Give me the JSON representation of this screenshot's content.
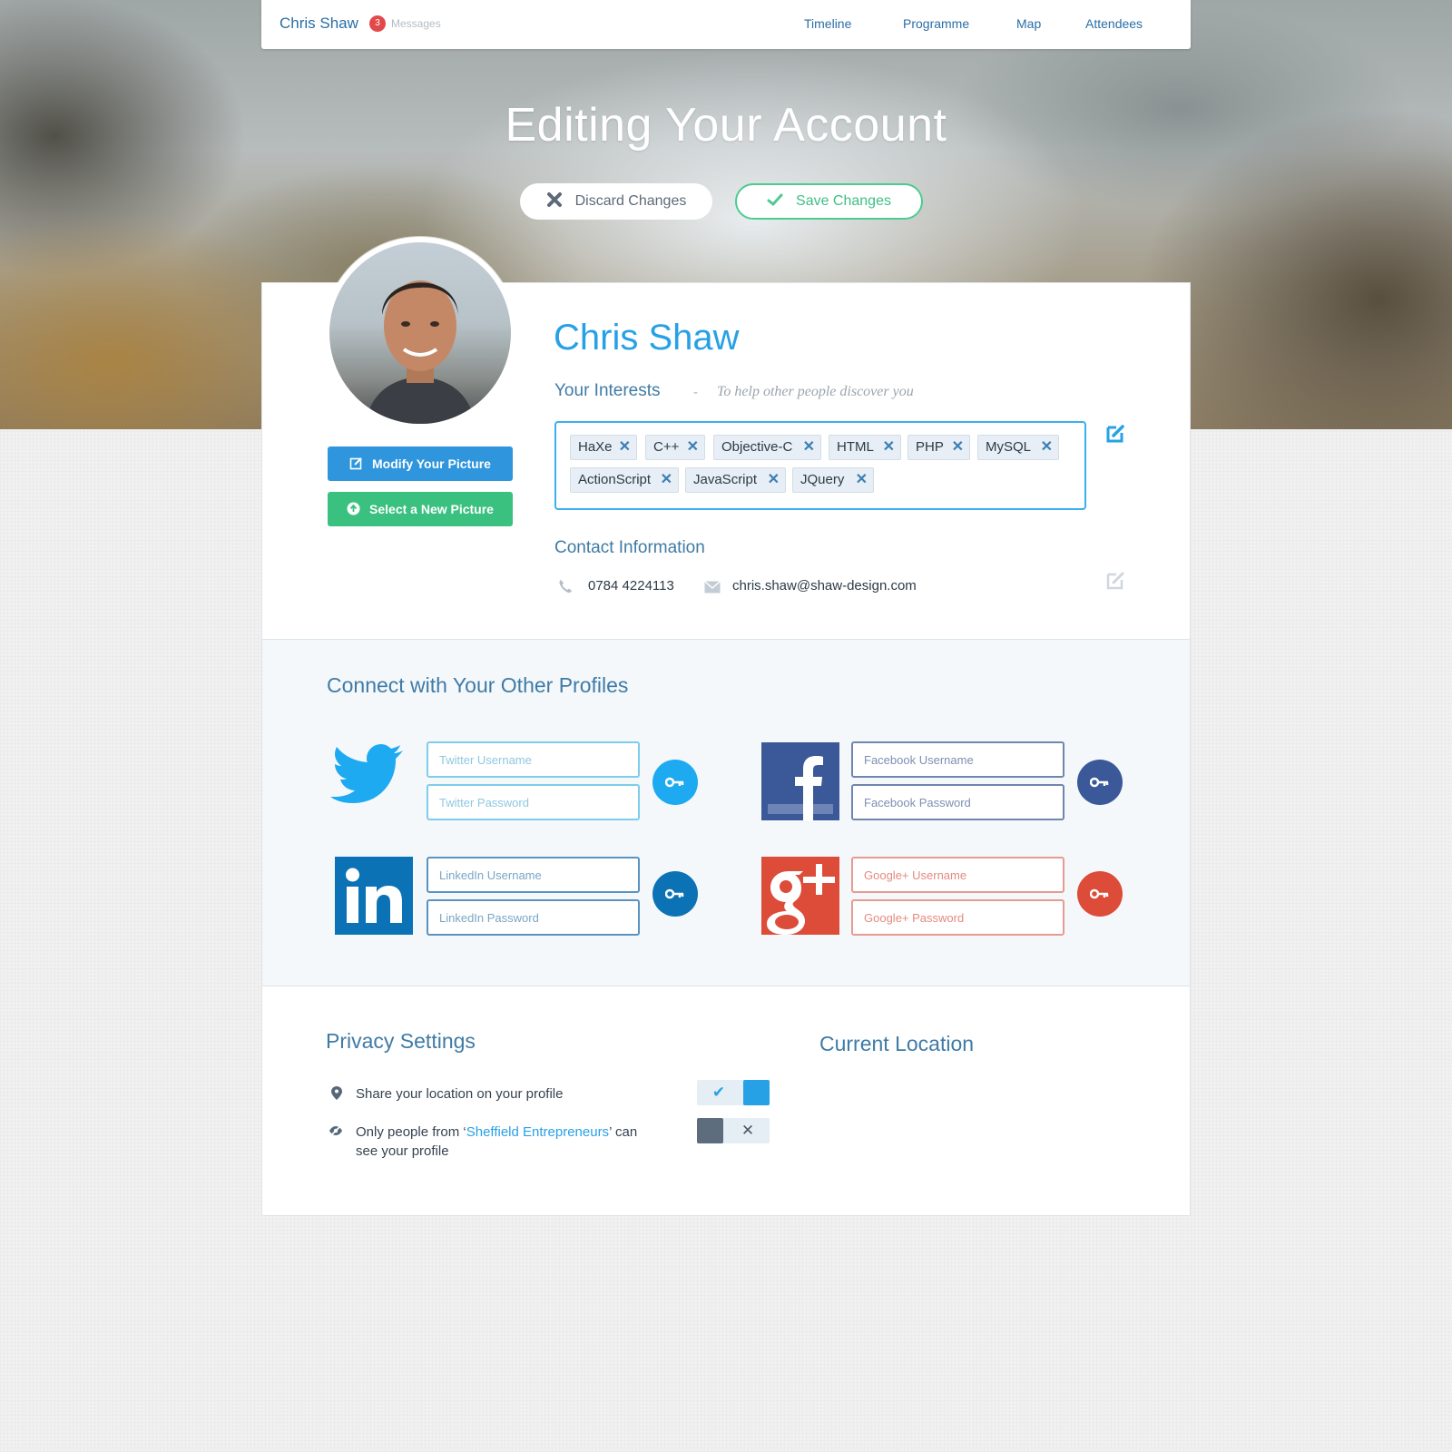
{
  "topbar": {
    "brand": "Chris Shaw",
    "message_count": "3",
    "messages_label": "Messages",
    "nav": [
      "Timeline",
      "Programme",
      "Map",
      "Attendees"
    ]
  },
  "hero": {
    "title": "Editing Your Account",
    "discard_label": "Discard Changes",
    "save_label": "Save Changes"
  },
  "profile": {
    "name": "Chris Shaw",
    "modify_picture_label": "Modify Your Picture",
    "select_picture_label": "Select a New Picture",
    "interests_heading": "Your Interests",
    "interests_dash": "-",
    "interests_subtitle": "To help other people  discover you",
    "interests": [
      "HaXe",
      "C++",
      "Objective-C",
      "HTML",
      "PHP",
      "MySQL",
      "ActionScript",
      "JavaScript",
      "JQuery"
    ],
    "tag_remove_glyph": "✕",
    "contact_heading": "Contact Information",
    "phone": "0784 4224113",
    "email": "chris.shaw@shaw-design.com"
  },
  "connect": {
    "heading": "Connect with Your Other Profiles",
    "twitter": {
      "username_placeholder": "Twitter Username",
      "password_placeholder": "Twitter Password",
      "color": "#1eaaf1"
    },
    "facebook": {
      "username_placeholder": "Facebook Username",
      "password_placeholder": "Facebook Password",
      "color": "#3b5998"
    },
    "linkedin": {
      "username_placeholder": "LinkedIn Username",
      "password_placeholder": "LinkedIn Password",
      "color": "#0c72b6"
    },
    "googleplus": {
      "username_placeholder": "Google+ Username",
      "password_placeholder": "Google+ Password",
      "color": "#dd4b39"
    }
  },
  "privacy": {
    "heading": "Privacy Settings",
    "share_location_label": "Share your location on your profile",
    "share_location_on": true,
    "restrict_prefix": "Only people from ‘",
    "restrict_group": "Sheffield Entrepreneurs",
    "restrict_suffix": "’ can",
    "restrict_line2": "see your profile",
    "restrict_on": false,
    "toggle_on_glyph": "✔",
    "toggle_off_glyph": "✕"
  },
  "location": {
    "heading": "Current Location"
  },
  "colors": {
    "accent": "#27a1e6",
    "heading": "#3f7ba6",
    "success": "#3ac07f",
    "danger": "#e2494b"
  }
}
